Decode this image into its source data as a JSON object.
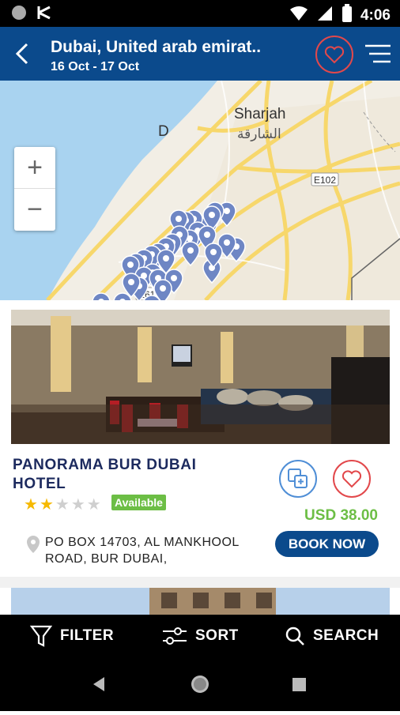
{
  "status_bar": {
    "time": "4:06"
  },
  "header": {
    "title": "Dubai, United arab emirat..",
    "dates": "16 Oct - 17 Oct"
  },
  "map": {
    "labels": {
      "sharjah_en": "Sharjah",
      "sharjah_ar": "الشارقة",
      "road_e102": "E102",
      "road_e61": "E61",
      "city_initial": "D"
    }
  },
  "hotel": {
    "name": "PANORAMA BUR DUBAI HOTEL",
    "rating": 2,
    "rating_max": 5,
    "availability": "Available",
    "price": "USD 38.00",
    "address": "PO BOX 14703, AL MANKHOOL ROAD, BUR DUBAI,",
    "book_label": "BOOK NOW"
  },
  "bottom_bar": {
    "filter_label": "FILTER",
    "sort_label": "SORT",
    "search_label": "SEARCH"
  },
  "colors": {
    "primary": "#0b4a8c",
    "accent_red": "#e2484b",
    "available_green": "#6cbe45",
    "star": "#f6b900"
  }
}
